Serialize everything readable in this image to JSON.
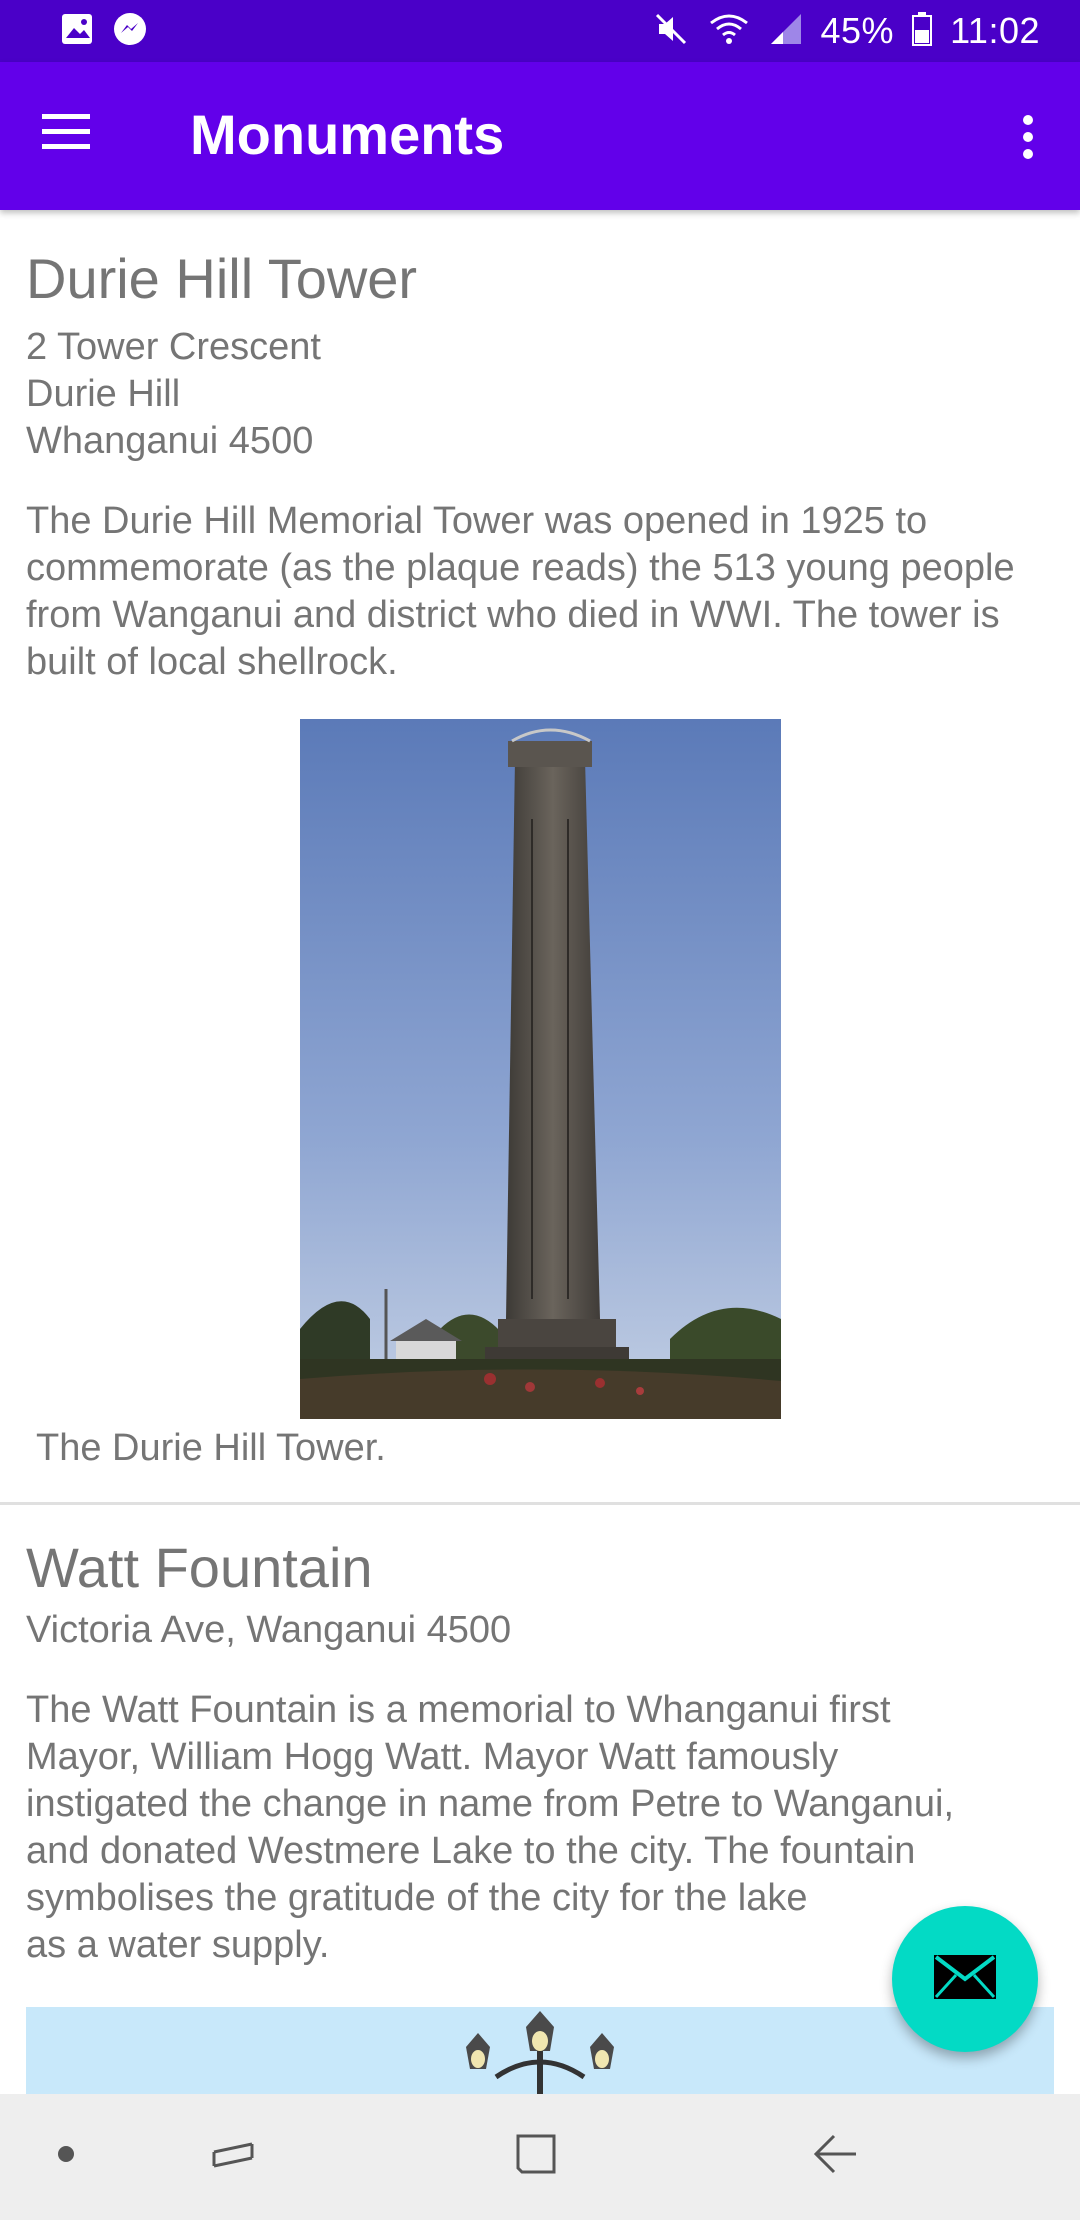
{
  "status_bar": {
    "battery": "45%",
    "time": "11:02",
    "left_icons": [
      "gallery-icon",
      "messenger-icon"
    ],
    "right_icons": [
      "mute-icon",
      "wifi-icon",
      "signal-icon",
      "battery-icon"
    ]
  },
  "app_bar": {
    "title": "Monuments",
    "menu_icon": "hamburger-menu-icon",
    "overflow_icon": "more-vertical-icon",
    "color": "#6200ea"
  },
  "monuments": [
    {
      "title": "Durie Hill Tower",
      "address": [
        "2 Tower Crescent",
        "Durie Hill",
        "Whanganui 4500"
      ],
      "description": "The Durie Hill Memorial Tower was opened in 1925 to commemorate (as the plaque reads) the 513 young people from Wanganui and district who died in WWI. The tower is built of local shellrock.",
      "caption": "The Durie Hill Tower."
    },
    {
      "title": "Watt Fountain",
      "address": [
        "Victoria Ave, Wanganui 4500"
      ],
      "description_lines": [
        "The Watt Fountain is a memorial to Whanganui first",
        "Mayor, William Hogg Watt. Mayor Watt famously",
        "instigated the change in name from Petre to Wanganui,",
        "and donated Westmere Lake to the city. The fountain",
        "symbolises the gratitude of the city for the lake",
        "as a water supply."
      ]
    }
  ],
  "fab": {
    "icon": "email-icon",
    "color": "#03dac5"
  },
  "nav_bar": {
    "items": [
      "dot-icon",
      "recent-apps-icon",
      "home-icon",
      "back-icon"
    ]
  }
}
